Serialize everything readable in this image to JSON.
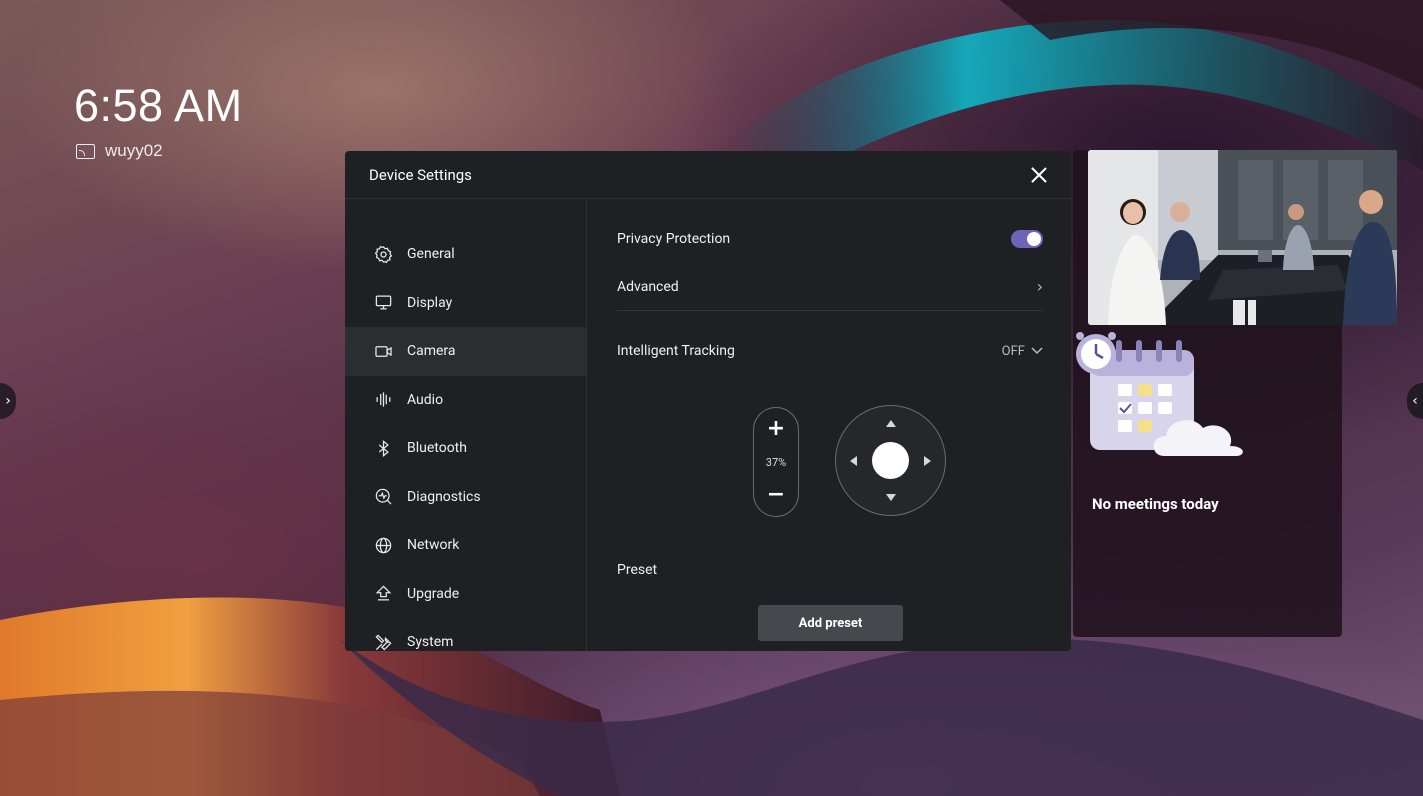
{
  "home": {
    "time": "6:58 AM",
    "device_name": "wuyy02"
  },
  "dialog": {
    "title": "Device Settings",
    "sidebar": {
      "items": [
        {
          "label": "General",
          "icon": "gear-icon"
        },
        {
          "label": "Display",
          "icon": "monitor-icon"
        },
        {
          "label": "Camera",
          "icon": "camera-icon",
          "active": true
        },
        {
          "label": "Audio",
          "icon": "audio-icon"
        },
        {
          "label": "Bluetooth",
          "icon": "bluetooth-icon"
        },
        {
          "label": "Diagnostics",
          "icon": "diagnostics-icon"
        },
        {
          "label": "Network",
          "icon": "globe-icon"
        },
        {
          "label": "Upgrade",
          "icon": "upgrade-icon"
        },
        {
          "label": "System",
          "icon": "tools-icon"
        }
      ]
    },
    "camera": {
      "privacy_label": "Privacy Protection",
      "privacy_enabled": true,
      "advanced_label": "Advanced",
      "tracking_label": "Intelligent Tracking",
      "tracking_value": "OFF",
      "zoom_plus": "+",
      "zoom_level": "37%",
      "zoom_minus": "−",
      "preset_label": "Preset",
      "add_preset_label": "Add preset"
    }
  },
  "meetings": {
    "empty_text": "No meetings today"
  },
  "colors": {
    "toggle_on": "#6e63b8",
    "dialog_bg": "#1f2023",
    "active_nav_bg": "#2c2d31"
  }
}
